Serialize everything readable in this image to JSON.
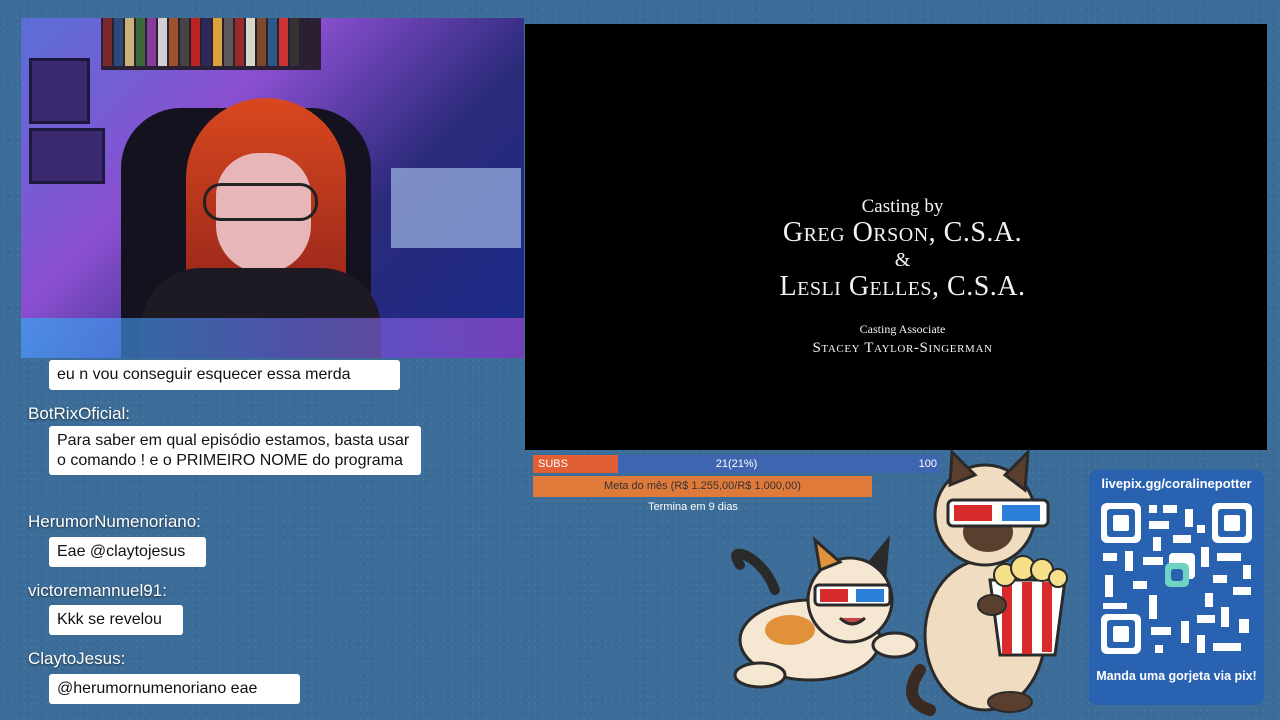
{
  "credits": {
    "line1": "Casting by",
    "name1": "Greg Orson, C.S.A.",
    "amp": "&",
    "name2": "Lesli Gelles, C.S.A.",
    "assoc_label": "Casting Associate",
    "assoc_name": "Stacey Taylor-Singerman"
  },
  "chat": [
    {
      "user": "",
      "message": "eu n vou conseguir esquecer essa merda"
    },
    {
      "user": "BotRixOficial:",
      "message": "Para saber em qual episódio estamos, basta usar o comando ! e o PRIMEIRO NOME do programa"
    },
    {
      "user": "HerumorNumenoriano:",
      "message": "Eae @claytojesus"
    },
    {
      "user": "victoremannuel91:",
      "message": "Kkk se revelou"
    },
    {
      "user": "ClaytoJesus:",
      "message": "@herumornumenoriano eae"
    }
  ],
  "subs": {
    "label": "SUBS",
    "progress_text": "21(21%)",
    "max": "100",
    "fraction": 0.21,
    "fill_color": "#e25f36",
    "bg_color": "#3f65b0"
  },
  "goal": {
    "text": "Meta do mês (R$ 1.255,00/R$ 1.000,00)",
    "ends": "Termina em 9 dias",
    "color": "#e07a3a"
  },
  "qr": {
    "url": "livepix.gg/coralinepotter",
    "caption": "Manda uma gorjeta via pix!"
  },
  "icons": [
    "qr-code-icon",
    "cats-3d-glasses-popcorn-illustration"
  ]
}
